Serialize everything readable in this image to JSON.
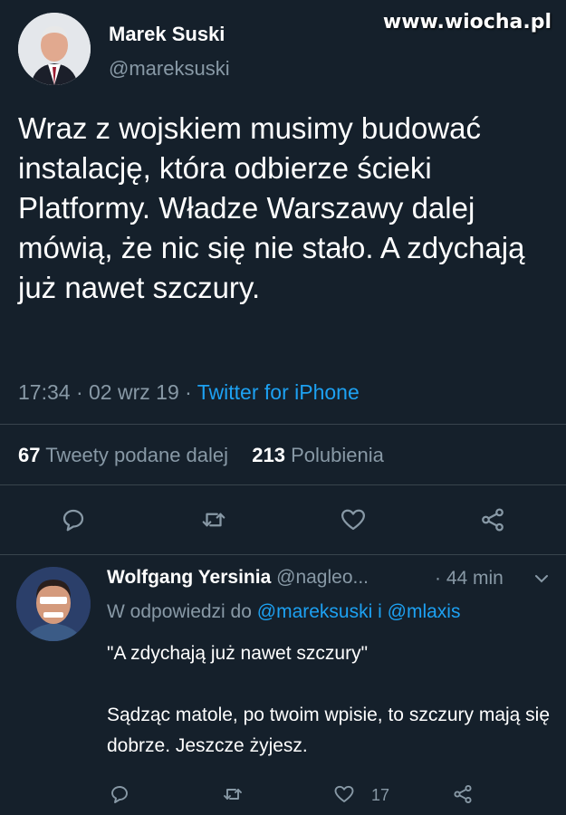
{
  "watermark": "www.wiocha.pl",
  "tweet": {
    "author_name": "Marek Suski",
    "author_handle": "@mareksuski",
    "text": "Wraz z wojskiem musimy budować instalację, która odbierze ścieki Platformy. Władze Warszawy dalej mówią, że nic się nie stało. A zdychają już nawet szczury.",
    "time": "17:34",
    "date": "02 wrz 19",
    "source": "Twitter for iPhone",
    "retweets_count": "67",
    "retweets_label": "Tweety podane dalej",
    "likes_count": "213",
    "likes_label": "Polubienia"
  },
  "reply": {
    "author_name": "Wolfgang Yersinia",
    "author_handle": "@nagleo...",
    "time": "· 44 min",
    "replying_prefix": "W odpowiedzi do",
    "replying_user1": "@mareksuski",
    "replying_and": "i",
    "replying_user2": "@mlaxis",
    "text_quote": "\"A zdychają już nawet szczury\"",
    "text_body": "Sądząc matole, po twoim wpisie, to szczury mają się dobrze. Jeszcze żyjesz.",
    "like_count": "17"
  },
  "icons": {
    "reply": "reply-icon",
    "retweet": "retweet-icon",
    "like": "heart-icon",
    "share": "share-icon",
    "menu": "chevron-down-icon"
  },
  "colors": {
    "background": "#15202b",
    "link": "#1da1f2",
    "secondary_text": "#8899a6",
    "divider": "#38444d"
  }
}
